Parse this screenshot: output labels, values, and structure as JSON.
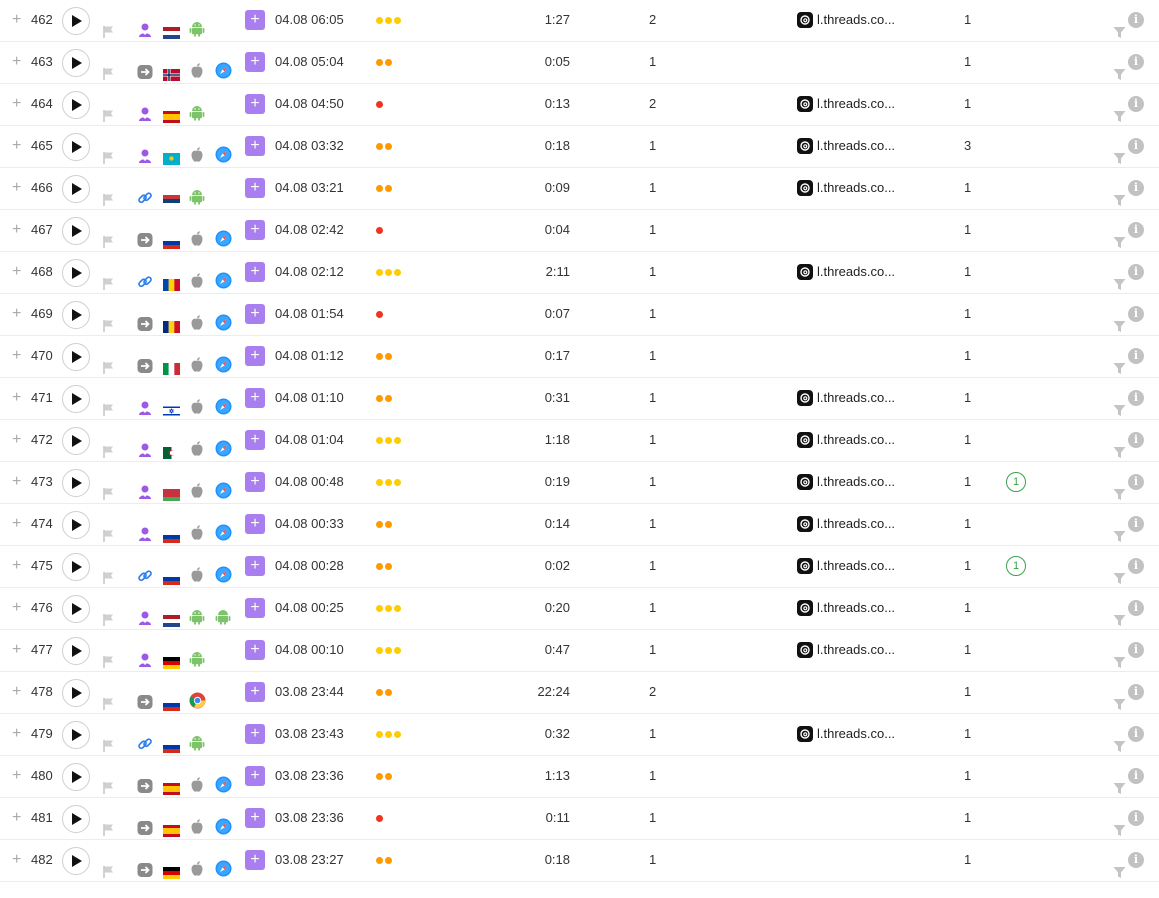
{
  "colors": {
    "accent_purple": "#a97ff0",
    "dot_green_yellow": "#ffcc00",
    "dot_orange": "#ff9900",
    "dot_red": "#f5321e",
    "badge_green": "#3aa24a"
  },
  "icons": {
    "expand": "plus-icon",
    "play": "play-icon",
    "mark": "flag-icon",
    "add": "plus-box-icon",
    "referrer": "threads-icon",
    "filter": "filter-icon",
    "info": "info-icon"
  },
  "ui": {
    "expand_glyph": "+",
    "add_glyph": "+",
    "info_glyph": "i"
  },
  "rows": [
    {
      "num": "462",
      "source": "person",
      "country": "nl",
      "os": "android",
      "browser": "",
      "datetime": "04.08 06:05",
      "dots": 3,
      "duration": "1:27",
      "pages": "2",
      "referrer": "l.threads.co...",
      "visits": "1",
      "badge": ""
    },
    {
      "num": "463",
      "source": "direct",
      "country": "no",
      "os": "apple",
      "browser": "safari",
      "datetime": "04.08 05:04",
      "dots": 2,
      "duration": "0:05",
      "pages": "1",
      "referrer": "",
      "visits": "1",
      "badge": ""
    },
    {
      "num": "464",
      "source": "person",
      "country": "es",
      "os": "android",
      "browser": "",
      "datetime": "04.08 04:50",
      "dots": 1,
      "duration": "0:13",
      "pages": "2",
      "referrer": "l.threads.co...",
      "visits": "1",
      "badge": ""
    },
    {
      "num": "465",
      "source": "person",
      "country": "kz",
      "os": "apple",
      "browser": "safari",
      "datetime": "04.08 03:32",
      "dots": 2,
      "duration": "0:18",
      "pages": "1",
      "referrer": "l.threads.co...",
      "visits": "3",
      "badge": ""
    },
    {
      "num": "466",
      "source": "link",
      "country": "rs",
      "os": "android",
      "browser": "",
      "datetime": "04.08 03:21",
      "dots": 2,
      "duration": "0:09",
      "pages": "1",
      "referrer": "l.threads.co...",
      "visits": "1",
      "badge": ""
    },
    {
      "num": "467",
      "source": "direct",
      "country": "ru",
      "os": "apple",
      "browser": "safari",
      "datetime": "04.08 02:42",
      "dots": 1,
      "duration": "0:04",
      "pages": "1",
      "referrer": "",
      "visits": "1",
      "badge": ""
    },
    {
      "num": "468",
      "source": "link",
      "country": "md",
      "os": "apple",
      "browser": "safari",
      "datetime": "04.08 02:12",
      "dots": 3,
      "duration": "2:11",
      "pages": "1",
      "referrer": "l.threads.co...",
      "visits": "1",
      "badge": ""
    },
    {
      "num": "469",
      "source": "direct",
      "country": "ro",
      "os": "apple",
      "browser": "safari",
      "datetime": "04.08 01:54",
      "dots": 1,
      "duration": "0:07",
      "pages": "1",
      "referrer": "",
      "visits": "1",
      "badge": ""
    },
    {
      "num": "470",
      "source": "direct",
      "country": "it",
      "os": "apple",
      "browser": "safari",
      "datetime": "04.08 01:12",
      "dots": 2,
      "duration": "0:17",
      "pages": "1",
      "referrer": "",
      "visits": "1",
      "badge": ""
    },
    {
      "num": "471",
      "source": "person",
      "country": "il",
      "os": "apple",
      "browser": "safari",
      "datetime": "04.08 01:10",
      "dots": 2,
      "duration": "0:31",
      "pages": "1",
      "referrer": "l.threads.co...",
      "visits": "1",
      "badge": ""
    },
    {
      "num": "472",
      "source": "person",
      "country": "dz",
      "os": "apple",
      "browser": "safari",
      "datetime": "04.08 01:04",
      "dots": 3,
      "duration": "1:18",
      "pages": "1",
      "referrer": "l.threads.co...",
      "visits": "1",
      "badge": ""
    },
    {
      "num": "473",
      "source": "person",
      "country": "by",
      "os": "apple",
      "browser": "safari",
      "datetime": "04.08 00:48",
      "dots": 3,
      "duration": "0:19",
      "pages": "1",
      "referrer": "l.threads.co...",
      "visits": "1",
      "badge": "1"
    },
    {
      "num": "474",
      "source": "person",
      "country": "ru",
      "os": "apple",
      "browser": "safari",
      "datetime": "04.08 00:33",
      "dots": 2,
      "duration": "0:14",
      "pages": "1",
      "referrer": "l.threads.co...",
      "visits": "1",
      "badge": ""
    },
    {
      "num": "475",
      "source": "link",
      "country": "ru",
      "os": "apple",
      "browser": "safari",
      "datetime": "04.08 00:28",
      "dots": 2,
      "duration": "0:02",
      "pages": "1",
      "referrer": "l.threads.co...",
      "visits": "1",
      "badge": "1"
    },
    {
      "num": "476",
      "source": "person",
      "country": "nl",
      "os": "android",
      "browser": "android",
      "datetime": "04.08 00:25",
      "dots": 3,
      "duration": "0:20",
      "pages": "1",
      "referrer": "l.threads.co...",
      "visits": "1",
      "badge": ""
    },
    {
      "num": "477",
      "source": "person",
      "country": "de",
      "os": "android",
      "browser": "",
      "datetime": "04.08 00:10",
      "dots": 3,
      "duration": "0:47",
      "pages": "1",
      "referrer": "l.threads.co...",
      "visits": "1",
      "badge": ""
    },
    {
      "num": "478",
      "source": "direct",
      "country": "ru",
      "os": "chrome",
      "browser": "",
      "datetime": "03.08 23:44",
      "dots": 2,
      "duration": "22:24",
      "pages": "2",
      "referrer": "",
      "visits": "1",
      "badge": ""
    },
    {
      "num": "479",
      "source": "link",
      "country": "ru",
      "os": "android",
      "browser": "",
      "datetime": "03.08 23:43",
      "dots": 3,
      "duration": "0:32",
      "pages": "1",
      "referrer": "l.threads.co...",
      "visits": "1",
      "badge": ""
    },
    {
      "num": "480",
      "source": "direct",
      "country": "es",
      "os": "apple",
      "browser": "safari",
      "datetime": "03.08 23:36",
      "dots": 2,
      "duration": "1:13",
      "pages": "1",
      "referrer": "",
      "visits": "1",
      "badge": ""
    },
    {
      "num": "481",
      "source": "direct",
      "country": "es",
      "os": "apple",
      "browser": "safari",
      "datetime": "03.08 23:36",
      "dots": 1,
      "duration": "0:11",
      "pages": "1",
      "referrer": "",
      "visits": "1",
      "badge": ""
    },
    {
      "num": "482",
      "source": "direct",
      "country": "de",
      "os": "apple",
      "browser": "safari",
      "datetime": "03.08 23:27",
      "dots": 2,
      "duration": "0:18",
      "pages": "1",
      "referrer": "",
      "visits": "1",
      "badge": ""
    }
  ]
}
